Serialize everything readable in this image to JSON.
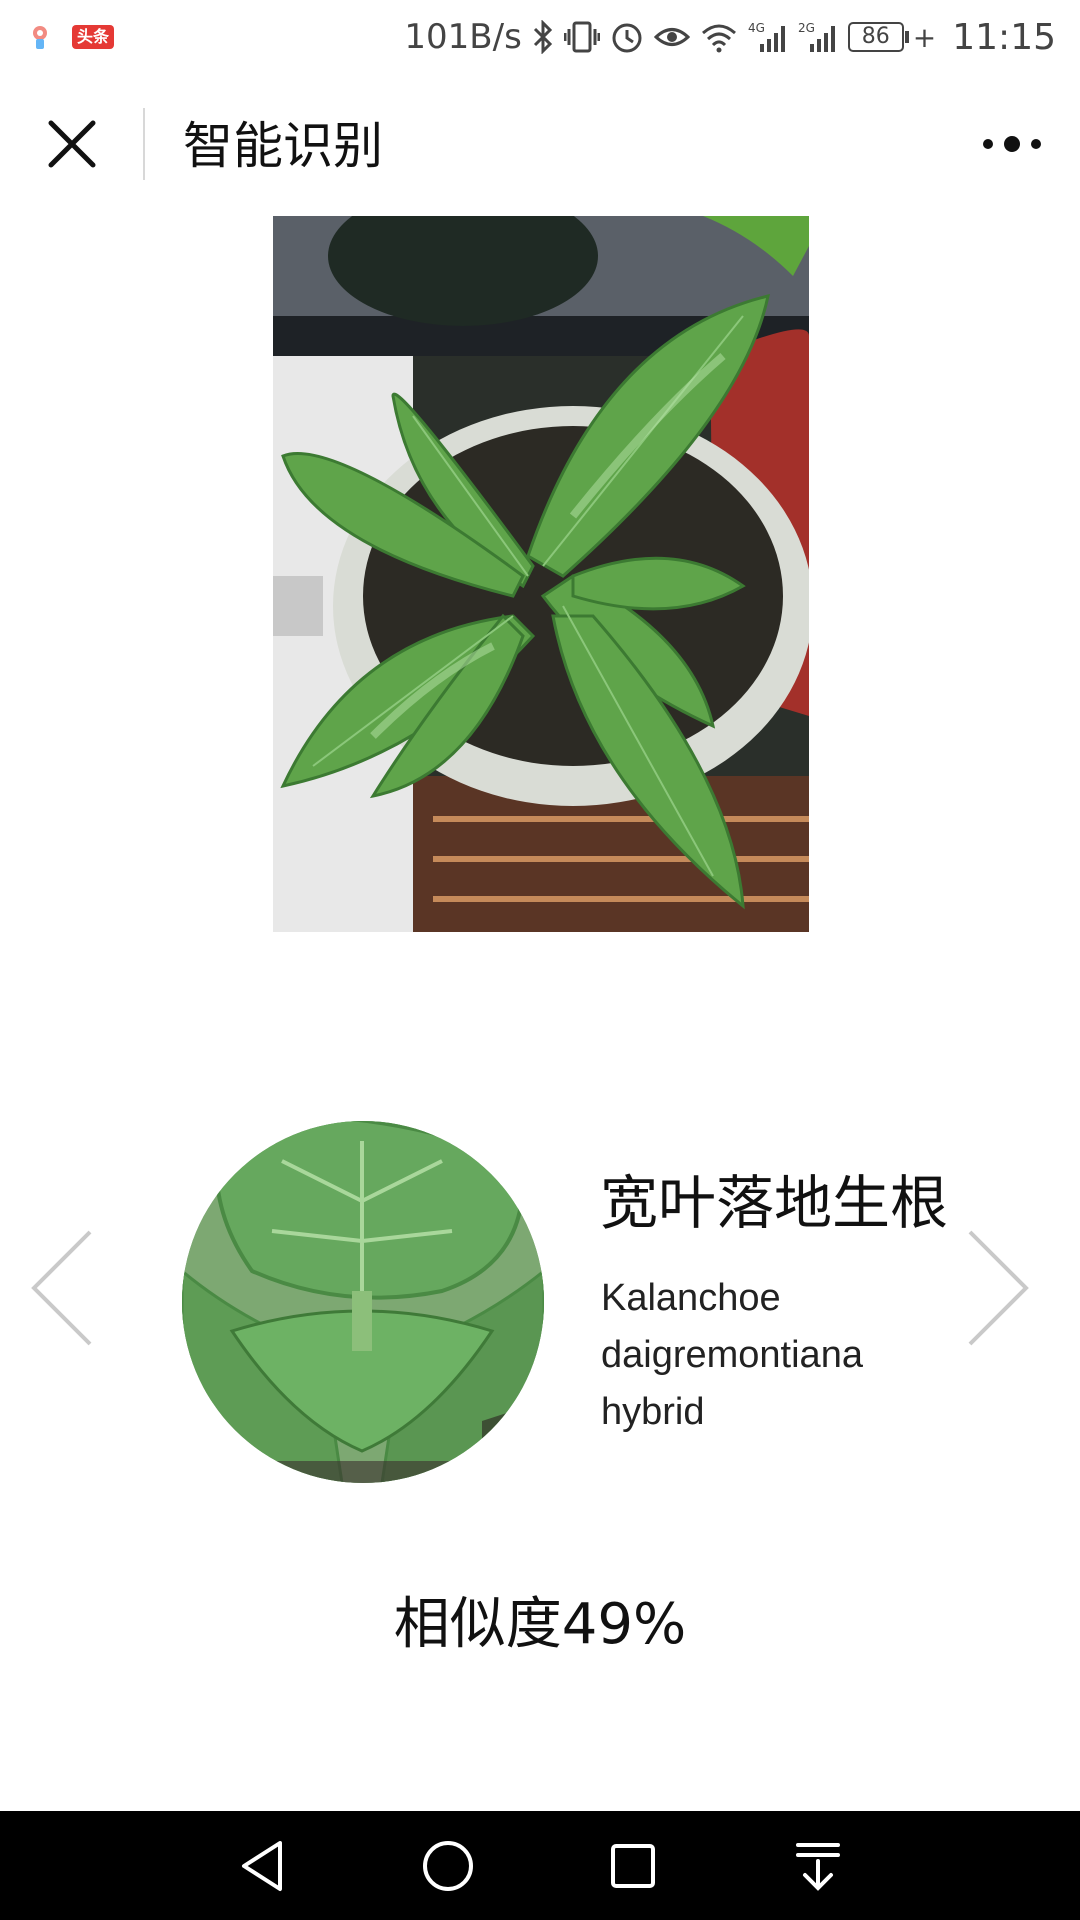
{
  "status_bar": {
    "app_badge": "头条",
    "speed": "101B/s",
    "battery": "86",
    "time": "11:15",
    "network_1": "4G",
    "network_2": "2G"
  },
  "nav": {
    "title": "智能识别"
  },
  "result": {
    "name": "宽叶落地生根",
    "latin_name": "Kalanchoe daigremontiana hybrid",
    "similarity": "相似度49%"
  },
  "colors": {
    "background": "#ffffff",
    "system_nav_bg": "#000000",
    "arrow": "#c9c9c9"
  }
}
